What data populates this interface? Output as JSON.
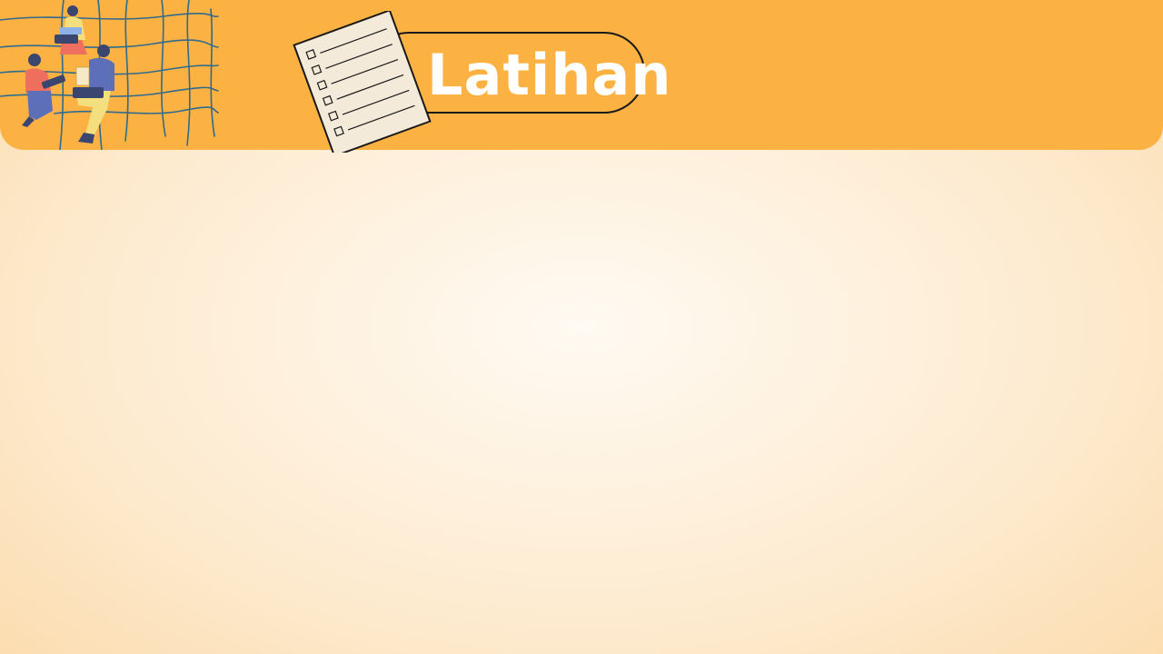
{
  "slide": {
    "title": "Latihan"
  },
  "colors": {
    "header_band": "#fcb243",
    "background_center": "#fffaf2",
    "background_edge": "#fcdcae",
    "title_text": "#ffffff",
    "pill_outline": "#1a1a1a",
    "paper": "#f3ead9",
    "grid_lines": "#2f6b8f"
  },
  "icons": {
    "checklist": "checklist-paper-icon",
    "people": "people-with-laptops-illustration",
    "grid": "hand-drawn-grid-decoration"
  }
}
